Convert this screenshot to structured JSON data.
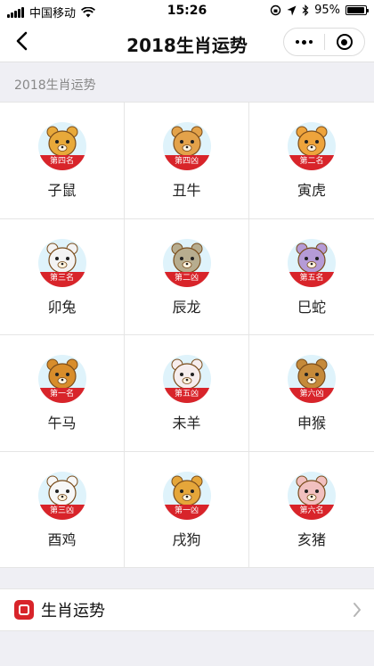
{
  "status_bar": {
    "carrier": "中国移动",
    "time": "15:26",
    "battery": "95%",
    "battery_level": 0.95
  },
  "navbar": {
    "title": "2018生肖运势",
    "back_icon": "chevron-left-icon",
    "more_icon": "more-dots-icon",
    "close_icon": "target-close-icon"
  },
  "section": {
    "title": "2018生肖运势"
  },
  "zodiac": [
    {
      "name": "子鼠",
      "rank": "第四名",
      "color": "#e8a93a"
    },
    {
      "name": "丑牛",
      "rank": "第四凶",
      "color": "#e3a24a"
    },
    {
      "name": "寅虎",
      "rank": "第二名",
      "color": "#eea43c"
    },
    {
      "name": "卯兔",
      "rank": "第三名",
      "color": "#f3f3f3"
    },
    {
      "name": "辰龙",
      "rank": "第二凶",
      "color": "#b7ad8f"
    },
    {
      "name": "巳蛇",
      "rank": "第五名",
      "color": "#b59bd6"
    },
    {
      "name": "午马",
      "rank": "第一名",
      "color": "#d88d2b"
    },
    {
      "name": "未羊",
      "rank": "第五凶",
      "color": "#f6eded"
    },
    {
      "name": "申猴",
      "rank": "第六凶",
      "color": "#c58a3a"
    },
    {
      "name": "酉鸡",
      "rank": "第三凶",
      "color": "#f7f7f7"
    },
    {
      "name": "戌狗",
      "rank": "第一凶",
      "color": "#e5a63a"
    },
    {
      "name": "亥猪",
      "rank": "第六名",
      "color": "#f1c0bf"
    }
  ],
  "footer": {
    "label": "生肖运势",
    "icon": "app-logo-icon",
    "chevron": "chevron-right-icon"
  },
  "colors": {
    "badge": "#d8242a",
    "avatar_bg": "#dff3fb",
    "page_bg": "#efeff4"
  }
}
